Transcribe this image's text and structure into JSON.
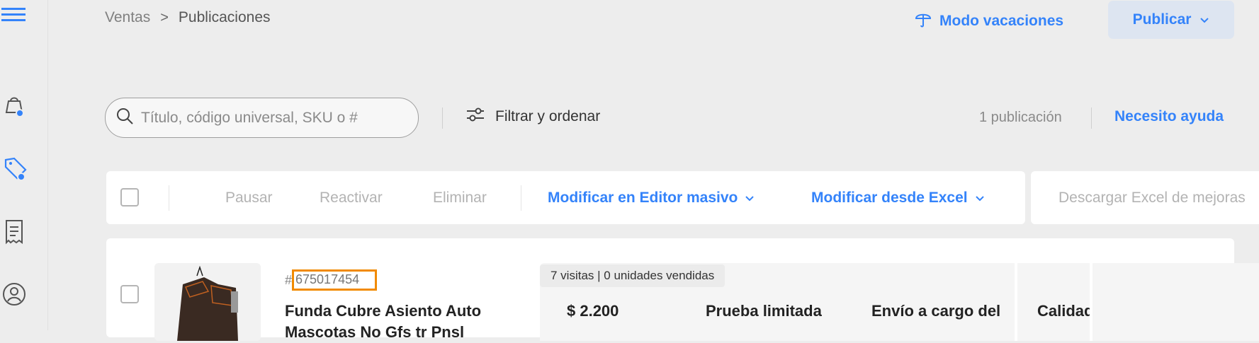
{
  "sidebar": {
    "items": [
      {
        "icon": "menu-icon"
      },
      {
        "icon": "shopping-bag-icon",
        "badge": true
      },
      {
        "icon": "price-tag-icon",
        "badge": true
      },
      {
        "icon": "receipt-icon"
      },
      {
        "icon": "user-circle-icon"
      }
    ]
  },
  "breadcrumb": {
    "parent": "Ventas",
    "separator": ">",
    "current": "Publicaciones"
  },
  "header": {
    "vacation_label": "Modo vacaciones",
    "publish_label": "Publicar"
  },
  "search": {
    "placeholder": "Título, código universal, SKU o #",
    "value": ""
  },
  "filter": {
    "label": "Filtrar y ordenar"
  },
  "results": {
    "count_label": "1 publicación",
    "help_label": "Necesito ayuda"
  },
  "toolbar": {
    "pause_label": "Pausar",
    "reactivate_label": "Reactivar",
    "delete_label": "Eliminar",
    "bulk_editor_label": "Modificar en Editor masivo",
    "excel_label": "Modificar desde Excel",
    "download_label": "Descargar Excel de mejoras"
  },
  "listing": {
    "hash": "#",
    "id": "675017454",
    "title": "Funda Cubre Asiento Auto Mascotas No Gfs tr Pnsl",
    "visits_label": "7 visitas | 0 unidades vendidas",
    "price": "$ 2.200",
    "promo": "Prueba limitada",
    "shipping": "Envío a cargo del",
    "quality": "Calidad"
  },
  "colors": {
    "accent": "#3483fa",
    "highlight": "#f18a00",
    "background": "#ededed"
  }
}
